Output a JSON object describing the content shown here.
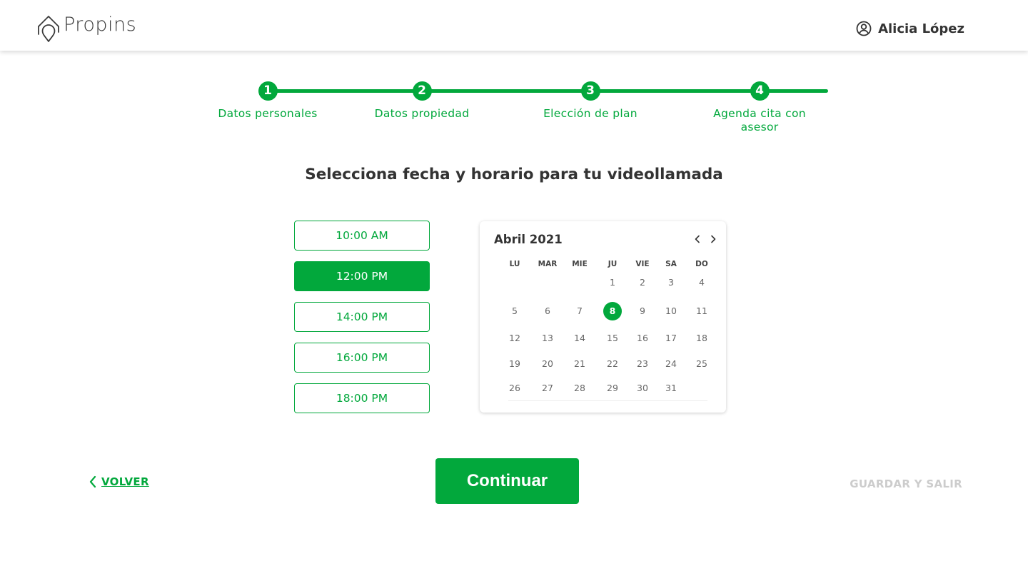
{
  "colors": {
    "accent": "#02a83c",
    "text_dark": "#333333",
    "muted": "#cccccc"
  },
  "header": {
    "logo_text": "Propins",
    "user_name": "Alicia López",
    "user_icon": "user-circle-icon"
  },
  "stepper": {
    "steps": [
      {
        "number": "1",
        "label": "Datos personales"
      },
      {
        "number": "2",
        "label": "Datos propiedad"
      },
      {
        "number": "3",
        "label": "Elección de plan"
      },
      {
        "number": "4",
        "label": "Agenda cita con asesor"
      }
    ]
  },
  "main": {
    "title": "Selecciona fecha y horario para tu videollamada"
  },
  "time_slots": {
    "items": [
      "10:00 AM",
      "12:00 PM",
      "14:00 PM",
      "16:00 PM",
      "18:00 PM"
    ],
    "selected": "12:00 PM"
  },
  "calendar": {
    "month_label": "Abril 2021",
    "prev_icon": "chevron-left-icon",
    "next_icon": "chevron-right-icon",
    "weekdays": [
      "LU",
      "MAR",
      "MIE",
      "JU",
      "VIE",
      "SA",
      "DO"
    ],
    "weeks": [
      [
        "",
        "",
        "",
        "1",
        "2",
        "3",
        "4"
      ],
      [
        "5",
        "6",
        "7",
        "8",
        "9",
        "10",
        "11"
      ],
      [
        "12",
        "13",
        "14",
        "15",
        "16",
        "17",
        "18"
      ],
      [
        "19",
        "20",
        "21",
        "22",
        "23",
        "24",
        "25"
      ],
      [
        "26",
        "27",
        "28",
        "29",
        "30",
        "31",
        ""
      ]
    ],
    "selected_day": "8"
  },
  "footer": {
    "back_label": "VOLVER",
    "continue_label": "Continuar",
    "save_exit_label": "GUARDAR Y SALIR"
  }
}
